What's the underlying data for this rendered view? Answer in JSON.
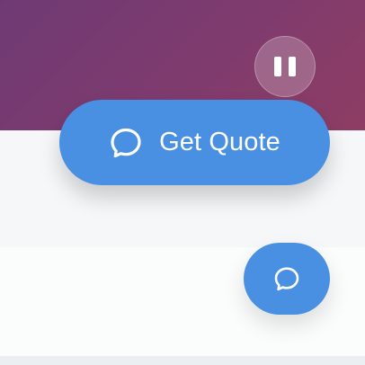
{
  "actions": {
    "pause_icon": "pause-icon",
    "quote_label": "Get Quote",
    "quote_icon": "chat-bubble-icon",
    "fab_icon": "chat-bubble-icon"
  },
  "colors": {
    "hero_gradient": [
      "#6f3a74",
      "#8e3d63"
    ],
    "primary_button": "#4a90e2",
    "light_section": "#f5f7f9",
    "footer_strip": "#eceff2"
  }
}
